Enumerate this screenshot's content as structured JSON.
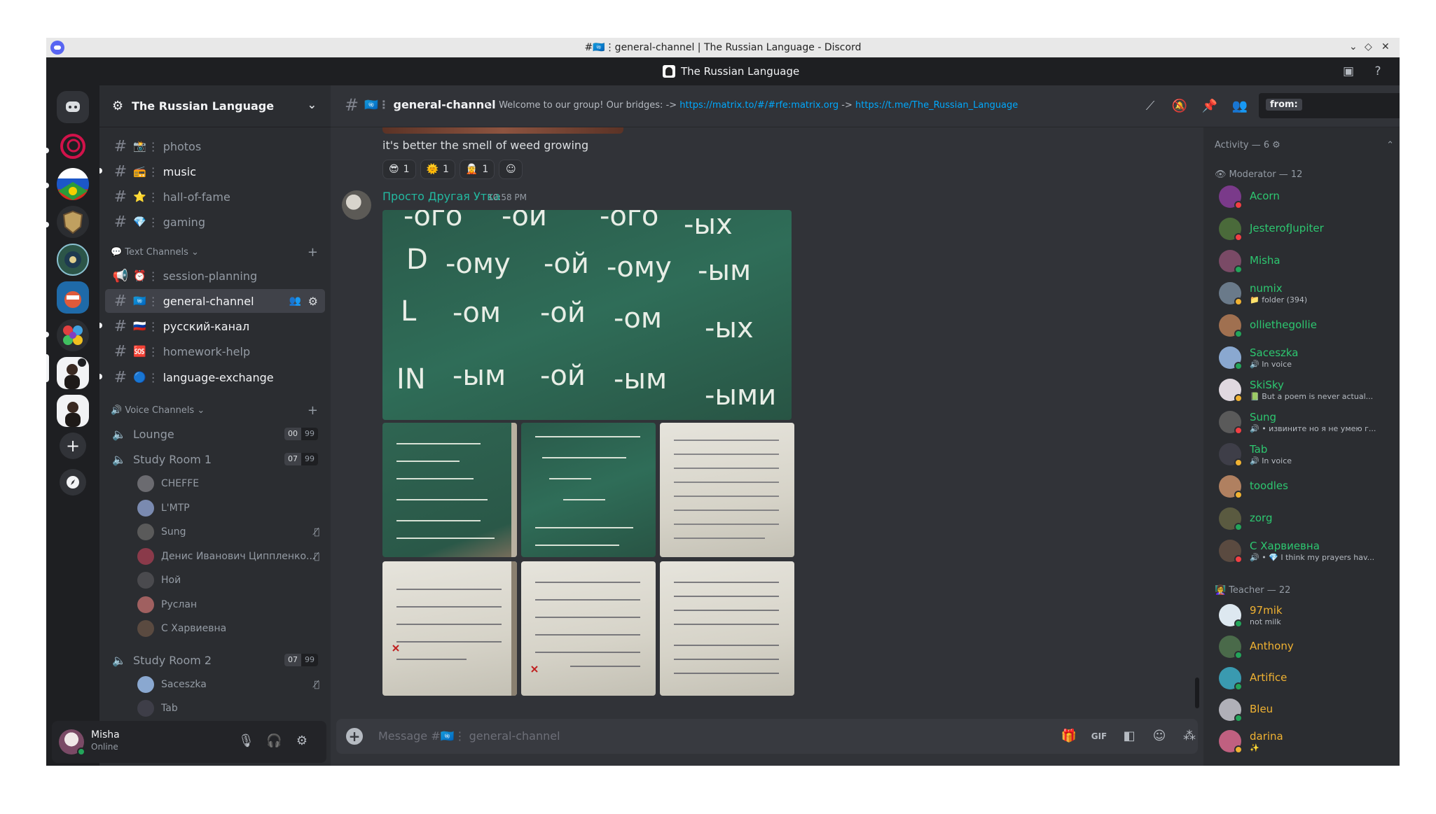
{
  "window": {
    "title": "#🇺🇳⋮general-channel | The Russian Language - Discord",
    "server_title": "The Russian Language"
  },
  "sidebar": {
    "server_name": "The Russian Language",
    "channels_top": [
      {
        "emoji": "📸",
        "name": "photos",
        "unread": false
      },
      {
        "emoji": "📻",
        "name": "music",
        "unread": true
      },
      {
        "emoji": "⭐",
        "name": "hall-of-fame",
        "unread": false
      },
      {
        "emoji": "💎",
        "name": "gaming",
        "unread": false
      }
    ],
    "text_category": "Text Channels",
    "text_channels": [
      {
        "emoji": "⏰",
        "name": "session-planning",
        "unread": false
      },
      {
        "emoji": "🇺🇳",
        "name": "general-channel",
        "unread": false
      },
      {
        "emoji": "🇷🇺",
        "name": "русский-канал",
        "unread": true
      },
      {
        "emoji": "🆘",
        "name": "homework-help",
        "unread": false
      },
      {
        "emoji": "🔵",
        "name": "language-exchange",
        "unread": true
      }
    ],
    "voice_category": "Voice Channels",
    "voice_channels": [
      {
        "name": "Lounge",
        "count": "00",
        "limit": "99",
        "users": []
      },
      {
        "name": "Study Room 1",
        "count": "07",
        "limit": "99",
        "users": [
          {
            "name": "CHEFFE",
            "muted": false,
            "color": "#6b6b70"
          },
          {
            "name": "L'MTP",
            "muted": false,
            "color": "#7a8ab0"
          },
          {
            "name": "Sung",
            "muted": true,
            "color": "#5a5a5a"
          },
          {
            "name": "Денис Иванович Циппленко...",
            "muted": true,
            "color": "#8a3a4a"
          },
          {
            "name": "Ной",
            "muted": false,
            "color": "#4a4a4e"
          },
          {
            "name": "Руслан",
            "muted": false,
            "color": "#a06060"
          },
          {
            "name": "С Харвиевна",
            "muted": false,
            "color": "#5a4a40"
          }
        ]
      },
      {
        "name": "Study Room 2",
        "count": "07",
        "limit": "99",
        "users": [
          {
            "name": "Saceszka",
            "muted": true,
            "color": "#8aa8d0"
          },
          {
            "name": "Tab",
            "muted": false,
            "color": "#3e3e48"
          }
        ]
      }
    ]
  },
  "user_panel": {
    "name": "Misha",
    "status": "Online"
  },
  "chat_header": {
    "channel": "general-channel",
    "channel_emoji": "🇺🇳",
    "topic_prefix": "Welcome to our group! Our bridges: ->",
    "link1": "https://matrix.to/#/#rfe:matrix.org",
    "arrow": "->",
    "link2": "https://t.me/The_Russian_Language",
    "search_chip": "from:"
  },
  "messages": [
    {
      "text": "it's better the smell of weed growing",
      "reactions": [
        {
          "emoji": "😎",
          "count": "1"
        },
        {
          "emoji": "🌞",
          "count": "1"
        },
        {
          "emoji": "🧝",
          "count": "1"
        }
      ]
    },
    {
      "author": "Просто Другая Утка",
      "time": "10:58 PM",
      "board_main_lines": [
        {
          "label": "D",
          "forms": [
            "-ому",
            "-ой",
            "-ому",
            "-ым"
          ]
        },
        {
          "label": "L",
          "forms": [
            "-ом",
            "-ой",
            "-ом",
            "-ых"
          ]
        },
        {
          "label": "IN",
          "forms": [
            "-ым",
            "-ой",
            "-ым",
            "-ыми"
          ]
        }
      ],
      "board_main_top": [
        "-ого",
        "-ой",
        "-ого",
        "-ых"
      ]
    }
  ],
  "composer": {
    "placeholder_prefix": "Message #",
    "placeholder_emoji": "🇺🇳",
    "placeholder_channel": "general-channel"
  },
  "members": {
    "activity_label": "Activity — 6",
    "sections": [
      {
        "title": "Moderator — 12",
        "icon": "👁",
        "members": [
          {
            "name": "Acorn",
            "sub": "",
            "status": "dnd",
            "color": "#7a3a8a"
          },
          {
            "name": "JesterofJupiter",
            "sub": "",
            "status": "dnd",
            "color": "#4a6a3a"
          },
          {
            "name": "Misha",
            "sub": "",
            "status": "online",
            "color": "#7a4a66"
          },
          {
            "name": "numix",
            "sub": "📁 folder (394)",
            "status": "idle",
            "color": "#6a7a8a"
          },
          {
            "name": "olliethegollie",
            "sub": "",
            "status": "online",
            "color": "#a07050"
          },
          {
            "name": "Saceszka",
            "sub": "🔊 In voice",
            "status": "online",
            "color": "#8aa8d0"
          },
          {
            "name": "SkiSky",
            "sub": "📗 But a poem is never actual...",
            "status": "idle",
            "color": "#e0d8e0"
          },
          {
            "name": "Sung",
            "sub": "🔊 • извините но я не умею г...",
            "status": "dnd",
            "color": "#5a5a5a"
          },
          {
            "name": "Tab",
            "sub": "🔊 In voice",
            "status": "idle",
            "color": "#3e3e48"
          },
          {
            "name": "toodles",
            "sub": "",
            "status": "idle",
            "color": "#b08060"
          },
          {
            "name": "zorg",
            "sub": "",
            "status": "online",
            "color": "#5a5a40"
          },
          {
            "name": "С Харвиевна",
            "sub": "🔊 • 💎 I think my prayers hav...",
            "status": "dnd",
            "color": "#5a4a40"
          }
        ]
      },
      {
        "title": "Teacher — 22",
        "icon": "👩‍🏫",
        "members": [
          {
            "name": "97mik",
            "sub": "not milk",
            "status": "online",
            "color": "#dde8f0"
          },
          {
            "name": "Anthony",
            "sub": "",
            "status": "online",
            "color": "#4a6a4a"
          },
          {
            "name": "Artifice",
            "sub": "",
            "status": "online",
            "color": "#3a9ab0"
          },
          {
            "name": "Bleu",
            "sub": "",
            "status": "online",
            "color": "#b0b0b8"
          },
          {
            "name": "darina",
            "sub": "✨",
            "status": "idle",
            "color": "#c06080"
          }
        ]
      }
    ]
  },
  "colors": {
    "online": "#23a55a",
    "idle": "#f0b232",
    "dnd": "#f23f43",
    "moderator_name": "#2dc770",
    "teacher_name": "#f0b232",
    "link": "#00a8fc",
    "author": "#23b9a0"
  }
}
